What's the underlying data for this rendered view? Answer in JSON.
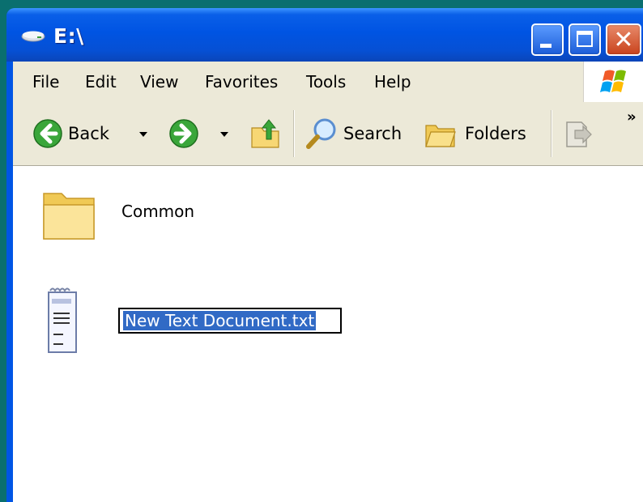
{
  "window": {
    "title": "E:\\",
    "title_icon": "drive-icon",
    "controls": {
      "minimize": "minimize-icon",
      "maximize": "maximize-icon",
      "close": "close-icon"
    }
  },
  "menu": [
    "File",
    "Edit",
    "View",
    "Favorites",
    "Tools",
    "Help"
  ],
  "toolbar": {
    "back_label": "Back",
    "search_label": "Search",
    "folders_label": "Folders",
    "more_glyph": "»"
  },
  "files": [
    {
      "name": "Common",
      "icon": "folder-icon"
    },
    {
      "name": "New Text Document.txt",
      "icon": "text-document-icon",
      "renaming": true
    }
  ],
  "colors": {
    "titlebar": "#0054e3",
    "selection": "#316ac5",
    "chrome": "#ece9d8"
  }
}
